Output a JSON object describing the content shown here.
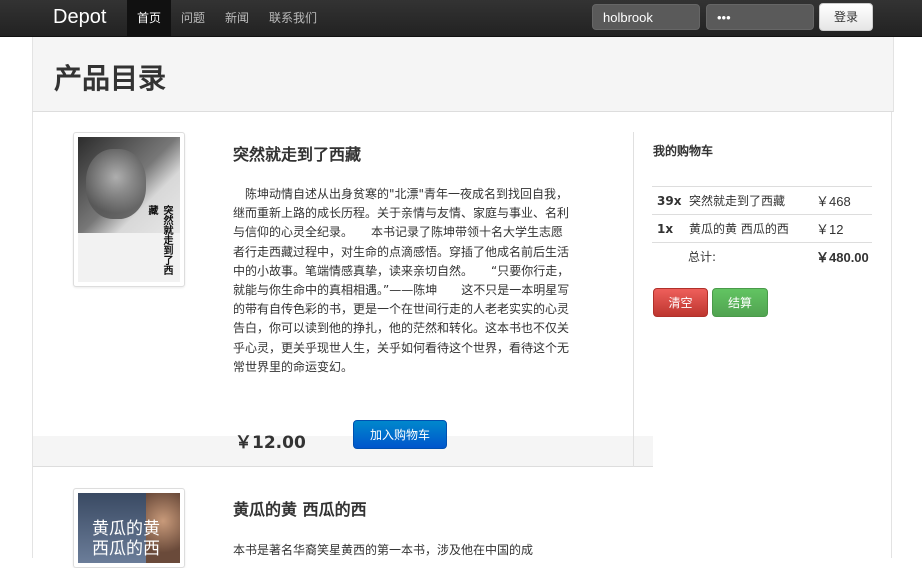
{
  "navbar": {
    "brand": "Depot",
    "items": [
      {
        "label": "首页",
        "active": true
      },
      {
        "label": "问题",
        "active": false
      },
      {
        "label": "新闻",
        "active": false
      },
      {
        "label": "联系我们",
        "active": false
      }
    ],
    "login": {
      "username_value": "holbrook",
      "password_value": "•••",
      "login_label": "登录"
    }
  },
  "page": {
    "title": "产品目录"
  },
  "products": [
    {
      "title": "突然就走到了西藏",
      "cover_text": "突然就走到了西藏",
      "description": "　陈坤动情自述从出身贫寒的\"北漂\"青年一夜成名到找回自我，继而重新上路的成长历程。关于亲情与友情、家庭与事业、名利与信仰的心灵全纪录。　　本书记录了陈坤带领十名大学生志愿者行走西藏过程中，对生命的点滴感悟。穿插了他成名前后生活中的小故事。笔端情感真挚，读来亲切自然。　　“只要你行走，就能与你生命中的真相相遇。”——陈坤　　这不只是一本明星写的带有自传色彩的书，更是一个在世间行走的人老老实实的心灵告白，你可以读到他的挣扎，他的茫然和转化。这本书也不仅关乎心灵，更关乎现世人生，关乎如何看待这个世界，看待这个无常世界里的命运变幻。",
      "price": "￥12.00",
      "add_label": "加入购物车"
    },
    {
      "title": "黄瓜的黄 西瓜的西",
      "cover_text": "黄瓜的黄 西瓜的西",
      "description": "本书是著名华裔笑星黄西的第一本书，涉及他在中国的成"
    }
  ],
  "cart": {
    "title": "我的购物车",
    "items": [
      {
        "qty": "39x",
        "name": "突然就走到了西藏",
        "price": "￥468"
      },
      {
        "qty": "1x",
        "name": "黄瓜的黄 西瓜的西",
        "price": "￥12"
      }
    ],
    "total_label": "总计:",
    "total_value": "￥480.00",
    "clear_label": "清空",
    "checkout_label": "结算"
  },
  "colors": {
    "navbar_bg": "#222222",
    "primary_button": "#0074cc",
    "danger_button": "#da4f49",
    "success_button": "#5bb75b"
  }
}
